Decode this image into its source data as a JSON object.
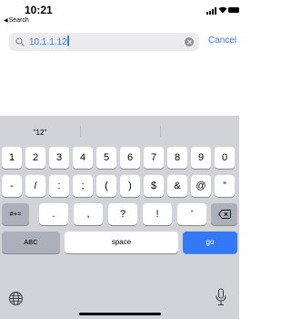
{
  "status": {
    "time": "10:21",
    "back_label": "Search",
    "back_arrow": "◀"
  },
  "search": {
    "value": "10.1.1.12",
    "cancel_label": "Cancel",
    "accent": "#3478f6"
  },
  "keyboard": {
    "suggestions": [
      "\"12\"",
      "",
      ""
    ],
    "row1": [
      "1",
      "2",
      "3",
      "4",
      "5",
      "6",
      "7",
      "8",
      "9",
      "0"
    ],
    "row2": [
      "-",
      "/",
      ":",
      ";",
      "(",
      ")",
      "$",
      "&",
      "@",
      "”"
    ],
    "row3": {
      "switch_label": "#+=",
      "keys": [
        ".",
        ",",
        "?",
        "!",
        "’"
      ],
      "delete_icon": "delete-icon"
    },
    "row4": {
      "abc_label": "ABC",
      "space_label": "space",
      "go_label": "go"
    },
    "globe_icon": "globe-icon",
    "mic_icon": "microphone-icon"
  }
}
